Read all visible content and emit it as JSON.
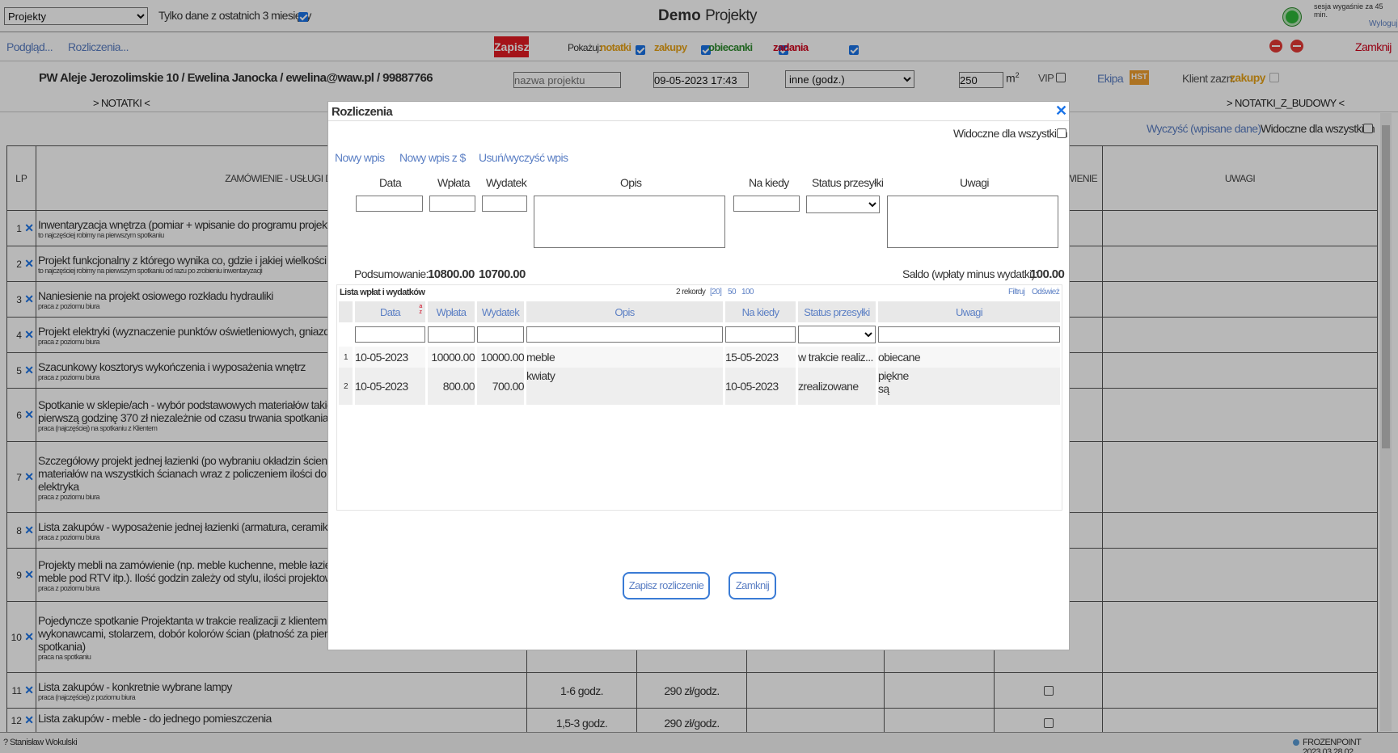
{
  "top": {
    "project_select": "Projekty",
    "recent_label": "Tylko dane z ostatnich 3 miesięcy",
    "title_bold": "Demo",
    "title_rest": "Projekty",
    "session_text": "sesja wygaśnie za 45 min.",
    "logout": "Wyloguj"
  },
  "bar2": {
    "preview": "Podgląd...",
    "settlements": "Rozliczenia...",
    "save": "Zapisz",
    "show_label": "Pokażuj:",
    "notes": "notatki",
    "purchases": "zakupy",
    "promises": "obiecanki",
    "tasks": "zadania",
    "close": "Zamknij"
  },
  "bar3": {
    "client_address": "PW Aleje Jerozolimskie 10",
    "client_name": "Ewelina Janocka",
    "client_email": "ewelina@waw.pl",
    "client_phone": "99887766",
    "project_name_placeholder": "nazwa projektu",
    "datetime": "09-05-2023 17:43",
    "type_select": "inne (godz.)",
    "area": "250",
    "area_unit": "m",
    "area_sup": "2",
    "vip": "VIP",
    "team": "Ekipa",
    "hst": "HST",
    "client_marked": "Klient zazn.",
    "client_marked_bold": "zakupy"
  },
  "tabs": {
    "notes": "> NOTATKI <",
    "notes_build": "> NOTATKI_Z_BUDOWY <"
  },
  "table_top": {
    "clear": "Wyczyść (wpisane dane)",
    "visible_all": "Widoczne dla wszystkich"
  },
  "main_table": {
    "headers": [
      "LP",
      "ZAMÓWIENIE - USŁUGI DE",
      "WIENIE",
      "UWAGI"
    ],
    "rows": [
      {
        "lp": "1",
        "text": "Inwentaryzacja wnętrza (pomiar + wpisanie do programu projektowego",
        "sub": "to najczęściej robimy na pierwszym spotkaniu"
      },
      {
        "lp": "2",
        "text": "Projekt funkcjonalny z którego wynika co, gdzie i jakiej wielkości się zm",
        "sub": "to najczęściej robimy na pierwszym spotkaniu od razu po zrobieniu inwentaryzacji"
      },
      {
        "lp": "3",
        "text": "Naniesienie na projekt osiowego rozkładu hydrauliki",
        "sub": "praca z poziomu biura"
      },
      {
        "lp": "4",
        "text": "Projekt elektryki (wyznaczenie punktów oświetleniowych, gniazdek, wł",
        "sub": "praca z poziomu biura"
      },
      {
        "lp": "5",
        "text": "Szacunkowy kosztorys wykończenia i wyposażenia wnętrz",
        "sub": "praca z poziomu biura"
      },
      {
        "lp": "6",
        "text": "Spotkanie w sklepie/ach - wybór podstawowych materiałów takich jak",
        "text2": "pierwszą godzinę 370 zł niezależnie od czasu trwania spotkania)",
        "sub": "praca (najczęściej) na spotkaniu z Klientem"
      },
      {
        "lp": "7",
        "text": "Szczegółowy projekt jednej łazienki (po wybraniu okładzin ściennych/p",
        "text2": "materiałów na wszystkich ścianach wraz z policzeniem ilości do zamów",
        "text3": "elektryka",
        "sub": "praca z poziomu biura"
      },
      {
        "lp": "8",
        "text": "Lista zakupów - wyposażenie jednej łazienki (armatura, ceramika, lam",
        "sub": "praca z poziomu biura"
      },
      {
        "lp": "9",
        "text": "Projekty mebli na zamówienie (np. meble kuchenne, meble łazienkow",
        "text2": "meble pod RTV itp.). Ilość godzin zależy od stylu, ilości projektowanych",
        "sub": "praca z poziomu biura"
      },
      {
        "lp": "10",
        "text": "Pojedyncze spotkanie Projektanta w trakcie realizacji z klientem (np. w",
        "text2": "wykonawcami, stolarzem, dobór kolorów ścian (płatność za pierwszą g",
        "text3": "spotkania)",
        "sub": "praca na spotkaniu"
      },
      {
        "lp": "11",
        "text": "Lista zakupów - konkretnie wybrane lampy",
        "sub": "praca (najczęściej) z poziomu biura",
        "hours": "1-6 godz.",
        "rate": "290 zł/godz."
      },
      {
        "lp": "12",
        "text": "Lista zakupów - meble - do jednego pomieszczenia",
        "sub": "",
        "hours": "1,5-3 godz.",
        "rate": "290 zł/godz."
      }
    ]
  },
  "modal": {
    "title": "Rozliczenia",
    "visible_all": "Widoczne dla wszystkich",
    "new_entry": "Nowy wpis",
    "new_entry_usd": "Nowy wpis z $",
    "delete_entry": "Usuń/wyczyść wpis",
    "form_labels": [
      "Data",
      "Wpłata",
      "Wydatek",
      "Opis",
      "Na kiedy",
      "Status przesyłki",
      "Uwagi"
    ],
    "summary_label": "Podsumowanie:",
    "summary_in": "10800.00",
    "summary_out": "10700.00",
    "saldo_label": "Saldo (wpłaty minus wydatki):",
    "saldo_value": "100.00",
    "list_title": "Lista wpłat i wydatków",
    "records": "2 rekordy",
    "page20": "[20]",
    "page50": "50",
    "page100": "100",
    "filter": "Filtruj",
    "refresh": "Odśwież",
    "sort_icon": "a z",
    "columns": [
      "Data",
      "Wpłata",
      "Wydatek",
      "Opis",
      "Na kiedy",
      "Status przesyłki",
      "Uwagi"
    ],
    "rows": [
      {
        "n": "1",
        "date": "10-05-2023",
        "in": "10000.00",
        "out": "10000.00",
        "desc": "meble",
        "due": "15-05-2023",
        "status": "w trakcie realiz...",
        "note": "obiecane",
        "note2": ""
      },
      {
        "n": "2",
        "date": "10-05-2023",
        "in": "800.00",
        "out": "700.00",
        "desc": "kwiaty",
        "due": "10-05-2023",
        "status": "zrealizowane",
        "note": "piękne",
        "note2": "są"
      }
    ],
    "save_btn": "Zapisz rozliczenie",
    "close_btn": "Zamknij"
  },
  "footer": {
    "user": "? Stanisław Wokulski",
    "brand": "FROZENPOINT 2023.03.28.02"
  },
  "colors": {
    "link": "#5b7fc4",
    "save_red": "#e31b23",
    "notes_color": "#e8a317",
    "purchases_color": "#e8a317",
    "promises_color": "#2e8b2e",
    "tasks_color": "#d0021b",
    "hst_bg": "#f0a030"
  }
}
